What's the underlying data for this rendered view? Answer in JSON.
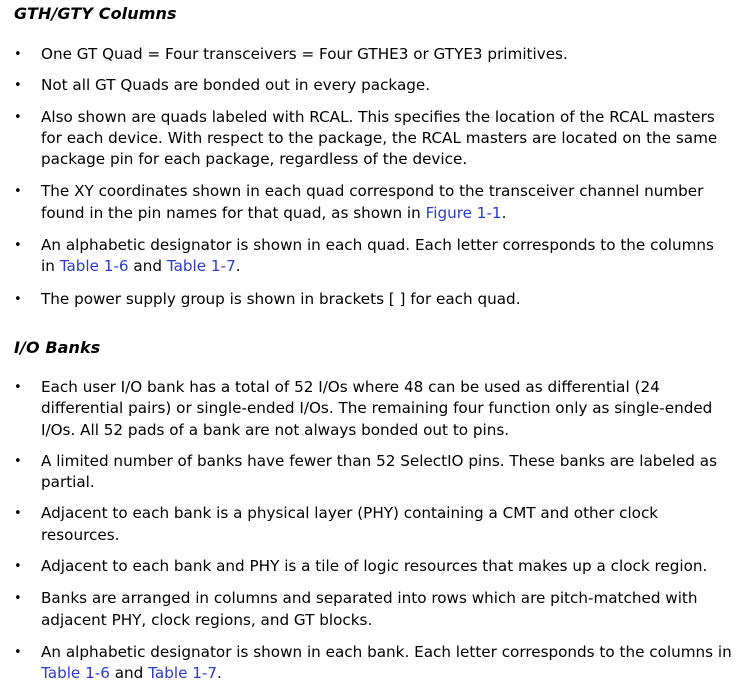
{
  "section1": {
    "heading": "GTH/GTY Columns",
    "bullets": [
      {
        "parts": [
          {
            "text": "One GT Quad = Four transceivers = Four GTHE3 or GTYE3 primitives."
          }
        ]
      },
      {
        "parts": [
          {
            "text": "Not all GT Quads are bonded out in every package."
          }
        ]
      },
      {
        "parts": [
          {
            "text": "Also shown are quads labeled with RCAL. This specifies the location of the RCAL masters for each device. With respect to the package, the RCAL masters are located on the same package pin for each package, regardless of the device."
          }
        ]
      },
      {
        "parts": [
          {
            "text": "The XY coordinates shown in each quad correspond to the transceiver channel number found in the pin names for that quad, as shown in "
          },
          {
            "text": "Figure 1-1",
            "link": true
          },
          {
            "text": "."
          }
        ]
      },
      {
        "parts": [
          {
            "text": "An alphabetic designator is shown in each quad. Each letter corresponds to the columns in "
          },
          {
            "text": "Table 1-6",
            "link": true
          },
          {
            "text": " and "
          },
          {
            "text": "Table 1-7",
            "link": true
          },
          {
            "text": "."
          }
        ]
      },
      {
        "parts": [
          {
            "text": "The power supply group is shown in brackets [ ] for each quad."
          }
        ]
      }
    ]
  },
  "section2": {
    "heading": "I/O Banks",
    "bullets": [
      {
        "parts": [
          {
            "text": "Each user I/O bank has a total of 52 I/Os where 48 can be used as differential (24 differential pairs) or single-ended I/Os. The remaining four function only as single-ended I/Os. All 52 pads of a bank are not always bonded out to pins."
          }
        ]
      },
      {
        "parts": [
          {
            "text": "A limited number of banks have fewer than 52 SelectIO pins. These banks are labeled as partial."
          }
        ]
      },
      {
        "parts": [
          {
            "text": "Adjacent to each bank is a physical layer (PHY) containing a CMT and other clock resources."
          }
        ]
      },
      {
        "parts": [
          {
            "text": "Adjacent to each bank and PHY is a tile of logic resources that makes up a clock region."
          }
        ]
      },
      {
        "parts": [
          {
            "text": "Banks are arranged in columns and separated into rows which are pitch-matched with adjacent PHY, clock regions, and GT blocks."
          }
        ]
      },
      {
        "parts": [
          {
            "text": "An alphabetic designator is shown in each bank. Each letter corresponds to the columns in "
          },
          {
            "text": "Table 1-6",
            "link": true
          },
          {
            "text": " and "
          },
          {
            "text": "Table 1-7",
            "link": true
          },
          {
            "text": "."
          }
        ]
      }
    ]
  },
  "bullet_glyph": "•",
  "colors": {
    "text": "#000000",
    "link": "#2a3cc8",
    "background": "#ffffff"
  }
}
